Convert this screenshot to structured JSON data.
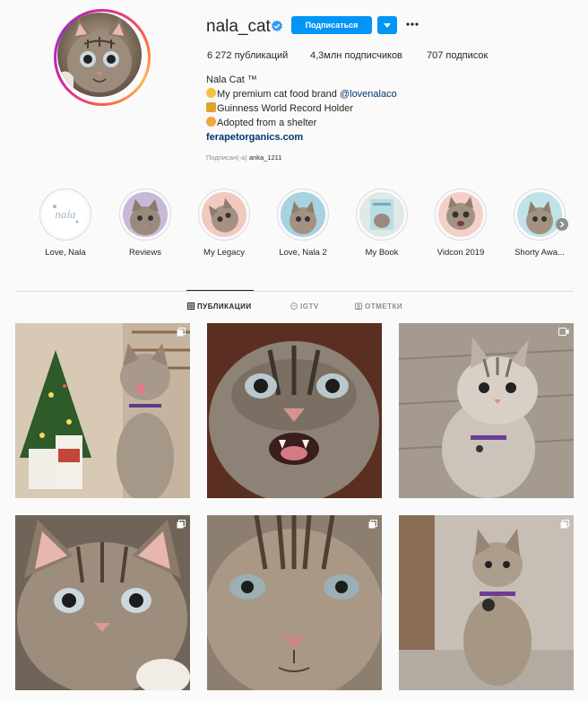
{
  "profile": {
    "username": "nala_cat",
    "follow_label": "Подписаться",
    "stats": {
      "posts": "6 272 публикаций",
      "followers": "4,3млн подписчиков",
      "following": "707 подписок"
    },
    "bio": {
      "name": "Nala Cat ™",
      "line1_text": "My premium cat food brand ",
      "line1_link": "@lovenalaco",
      "line2": "Guinness World Record Holder",
      "line3": "Adopted from a shelter",
      "website": "ferapetorganics.com"
    },
    "followed_by_prefix": "Подписан(-а)",
    "followed_by_user": "anka_1211"
  },
  "highlights": [
    {
      "label": "Love, Nala"
    },
    {
      "label": "Reviews"
    },
    {
      "label": "My Legacy"
    },
    {
      "label": "Love, Nala 2"
    },
    {
      "label": "My Book"
    },
    {
      "label": "Vidcon 2019"
    },
    {
      "label": "Shorty Awa..."
    }
  ],
  "tabs": {
    "posts": "ПУБЛИКАЦИИ",
    "igtv": "IGTV",
    "tagged": "ОТМЕТКИ"
  },
  "icons": {
    "verified": "verified-badge-icon",
    "more": "more-options-icon",
    "grid": "grid-icon",
    "igtv": "igtv-icon",
    "tagged": "tagged-icon",
    "carousel": "carousel-icon",
    "video": "video-icon"
  },
  "colors": {
    "primary_button": "#0095f6",
    "link": "#00376b",
    "verified": "#3897f0"
  }
}
